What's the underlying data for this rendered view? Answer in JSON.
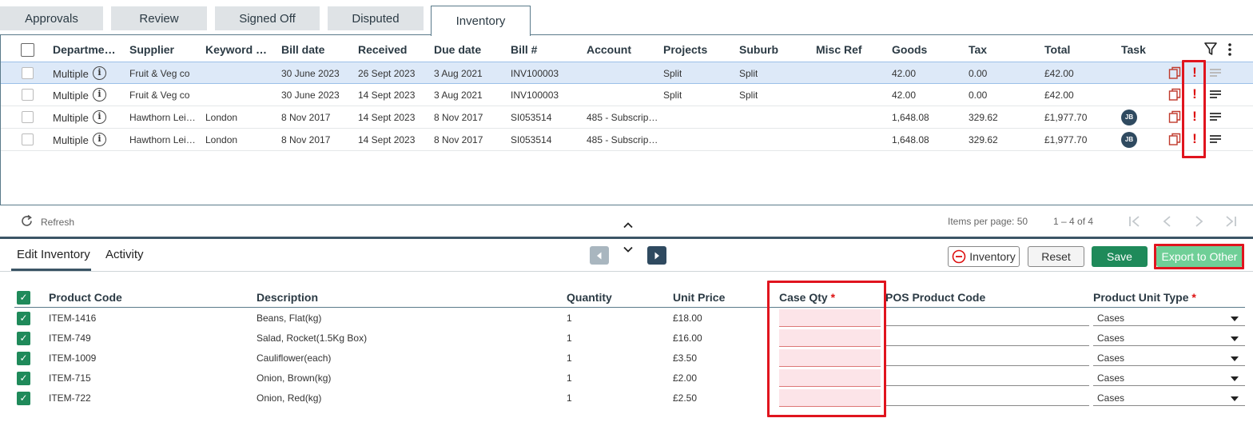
{
  "tabs": [
    "Approvals",
    "Review",
    "Signed Off",
    "Disputed",
    "Inventory"
  ],
  "grid": {
    "headers": [
      "Departme…",
      "Supplier",
      "Keyword …",
      "Bill date",
      "Received",
      "Due date",
      "Bill #",
      "Account",
      "Projects",
      "Suburb",
      "Misc Ref",
      "Goods",
      "Tax",
      "Total",
      "Task"
    ],
    "rows": [
      {
        "dept": "Multiple",
        "supplier": "Fruit & Veg co",
        "keyword": "",
        "bill_date": "30 June 2023",
        "received": "26 Sept 2023",
        "due": "3 Aug 2021",
        "bill": "INV100003",
        "account": "",
        "projects": "Split",
        "suburb": "Split",
        "misc": "",
        "goods": "42.00",
        "tax": "0.00",
        "total": "£42.00",
        "task": ""
      },
      {
        "dept": "Multiple",
        "supplier": "Fruit & Veg co",
        "keyword": "",
        "bill_date": "30 June 2023",
        "received": "14 Sept 2023",
        "due": "3 Aug 2021",
        "bill": "INV100003",
        "account": "",
        "projects": "Split",
        "suburb": "Split",
        "misc": "",
        "goods": "42.00",
        "tax": "0.00",
        "total": "£42.00",
        "task": ""
      },
      {
        "dept": "Multiple",
        "supplier": "Hawthorn Leis…",
        "keyword": "London",
        "bill_date": "8 Nov 2017",
        "received": "14 Sept 2023",
        "due": "8 Nov 2017",
        "bill": "SI053514",
        "account": "485 - Subscript…",
        "projects": "",
        "suburb": "",
        "misc": "",
        "goods": "1,648.08",
        "tax": "329.62",
        "total": "£1,977.70",
        "task": "JB"
      },
      {
        "dept": "Multiple",
        "supplier": "Hawthorn Leis…",
        "keyword": "London",
        "bill_date": "8 Nov 2017",
        "received": "14 Sept 2023",
        "due": "8 Nov 2017",
        "bill": "SI053514",
        "account": "485 - Subscript…",
        "projects": "",
        "suburb": "",
        "misc": "",
        "goods": "1,648.08",
        "tax": "329.62",
        "total": "£1,977.70",
        "task": "JB"
      }
    ],
    "footer": {
      "refresh": "Refresh",
      "items_per_page": "Items per page: 50",
      "range": "1 – 4 of 4"
    }
  },
  "editor": {
    "tabs": [
      "Edit Inventory",
      "Activity"
    ],
    "buttons": {
      "inventory": "Inventory",
      "reset": "Reset",
      "save": "Save",
      "export": "Export to Other"
    },
    "headers": {
      "product_code": "Product Code",
      "description": "Description",
      "quantity": "Quantity",
      "unit_price": "Unit Price",
      "case_qty": "Case Qty",
      "pos_code": "POS Product Code",
      "unit_type": "Product Unit Type",
      "required_mark": "*"
    },
    "items": [
      {
        "code": "ITEM-1416",
        "desc": "Beans, Flat(kg)",
        "qty": "1",
        "price": "£18.00",
        "case_qty": "",
        "pos": "",
        "unit_type": "Cases"
      },
      {
        "code": "ITEM-749",
        "desc": "Salad, Rocket(1.5Kg Box)",
        "qty": "1",
        "price": "£16.00",
        "case_qty": "",
        "pos": "",
        "unit_type": "Cases"
      },
      {
        "code": "ITEM-1009",
        "desc": "Cauliflower(each)",
        "qty": "1",
        "price": "£3.50",
        "case_qty": "",
        "pos": "",
        "unit_type": "Cases"
      },
      {
        "code": "ITEM-715",
        "desc": "Onion, Brown(kg)",
        "qty": "1",
        "price": "£2.00",
        "case_qty": "",
        "pos": "",
        "unit_type": "Cases"
      },
      {
        "code": "ITEM-722",
        "desc": "Onion, Red(kg)",
        "qty": "1",
        "price": "£2.50",
        "case_qty": "",
        "pos": "",
        "unit_type": "Cases"
      }
    ]
  },
  "colors": {
    "highlight": "#e0141e",
    "save": "#1f8a5a",
    "export": "#6fcf97",
    "selected_row": "#dde9f8"
  }
}
